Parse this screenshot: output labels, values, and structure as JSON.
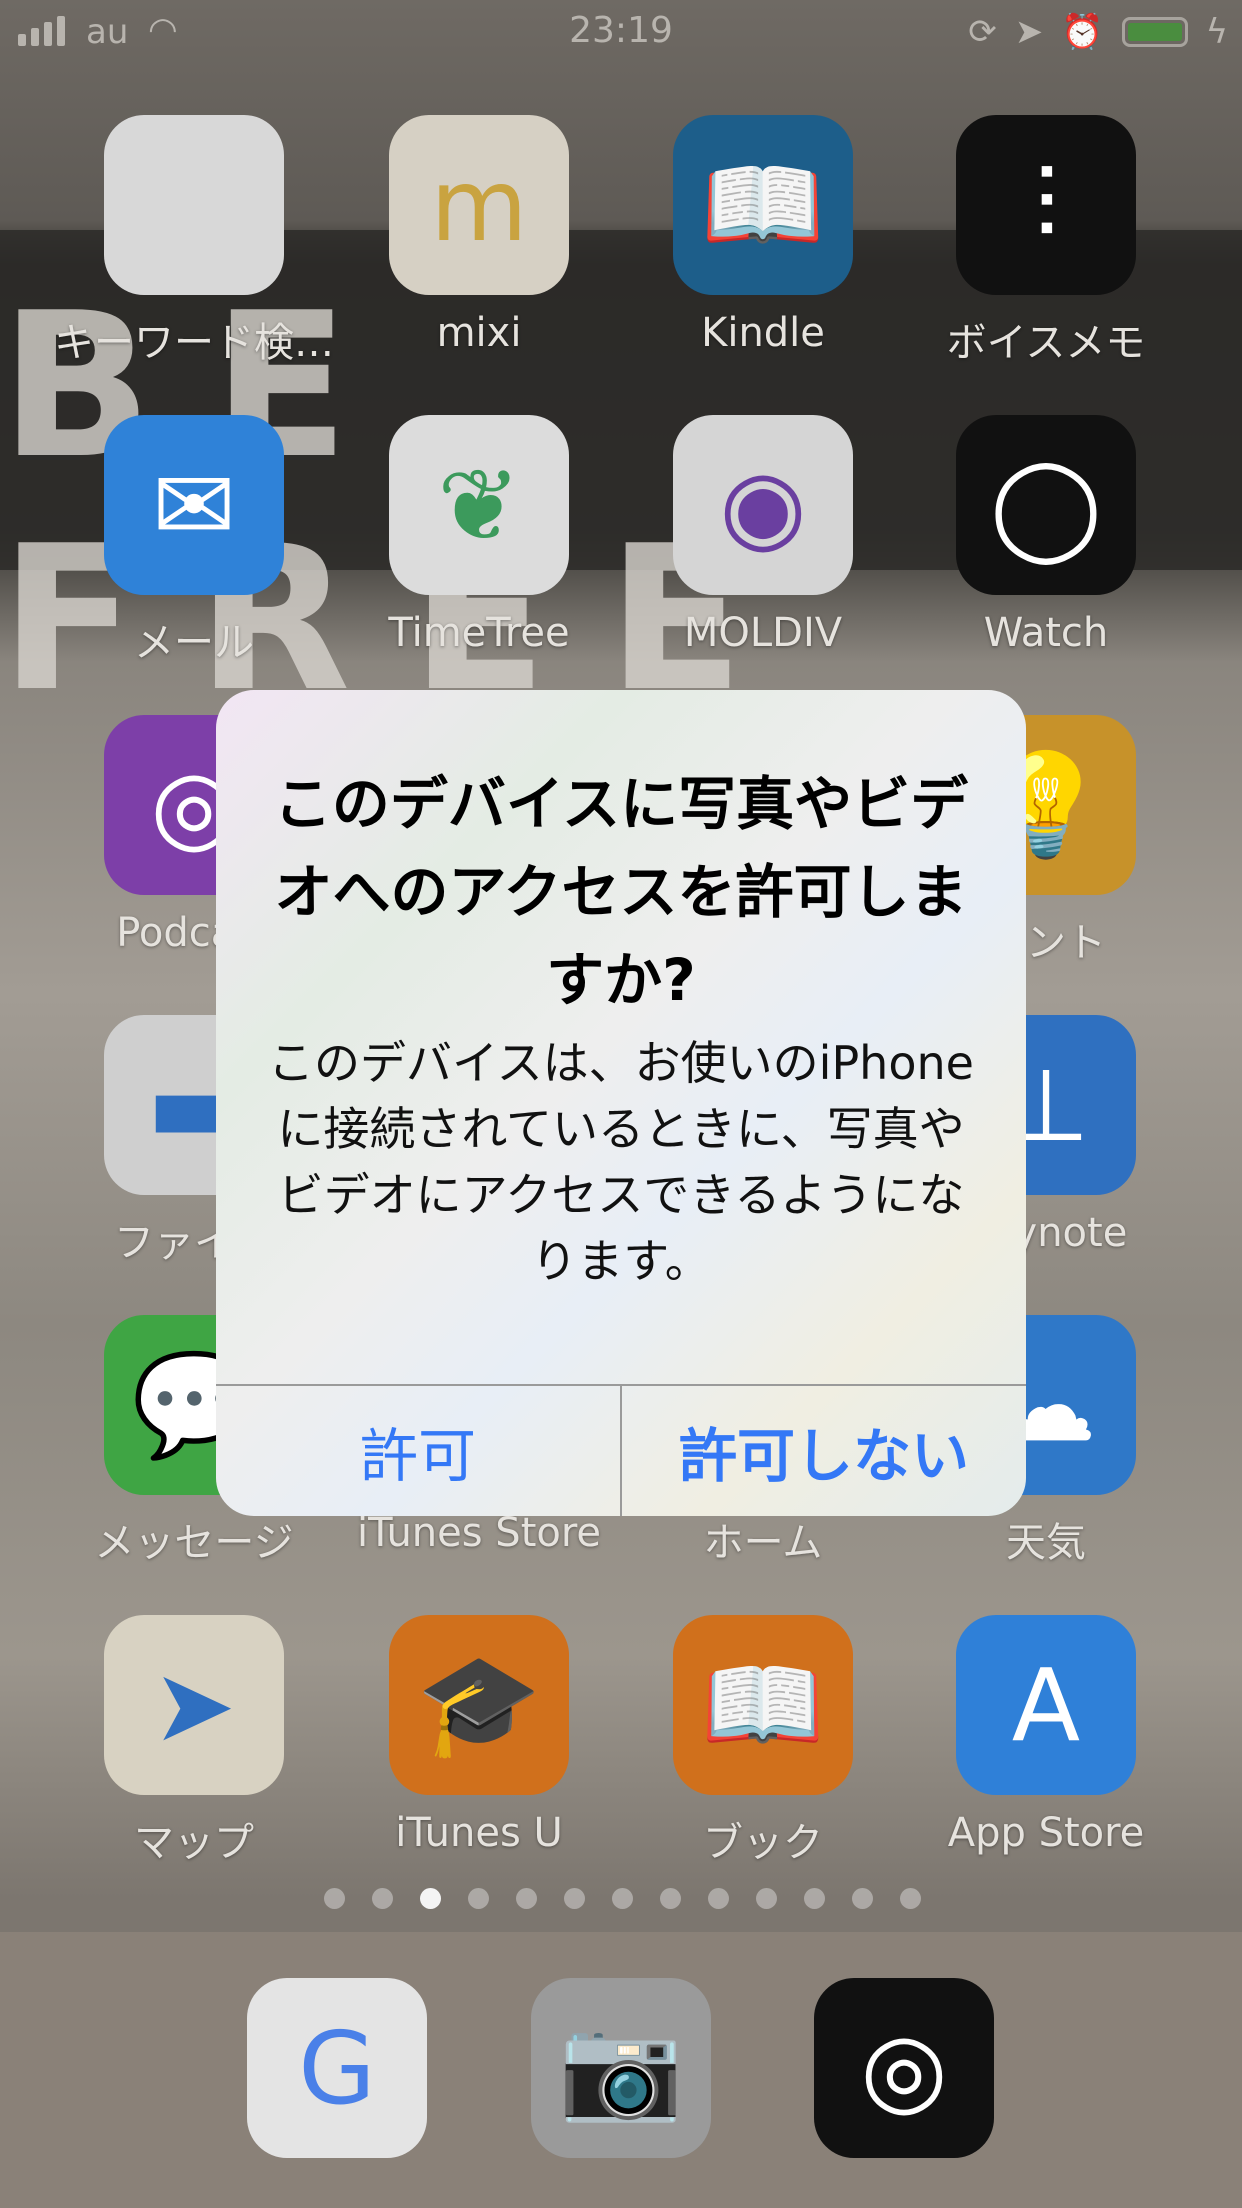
{
  "status_bar": {
    "carrier": "au",
    "time": "23:19",
    "battery_color": "#4a8d3f",
    "icons": [
      "signal-icon",
      "wifi-icon",
      "rotation-lock-icon",
      "location-icon",
      "alarm-icon",
      "battery-icon",
      "charging-icon"
    ]
  },
  "wallpaper_text": "BE FREE",
  "apps": [
    {
      "label": "キーワード検…",
      "color": "#d8d8d8",
      "glyph": ""
    },
    {
      "label": "mixi",
      "color": "#d6d0c4",
      "glyph": "m",
      "glyph_color": "#c9a340"
    },
    {
      "label": "Kindle",
      "color": "#1d5e8a",
      "glyph": "📖"
    },
    {
      "label": "ボイスメモ",
      "color": "#111111",
      "glyph": "⫶"
    },
    {
      "label": "メール",
      "color": "#2f82d8",
      "glyph": "✉"
    },
    {
      "label": "TimeTree",
      "color": "#dcdcdc",
      "glyph": "❦",
      "glyph_color": "#3c9a5c"
    },
    {
      "label": "MOLDIV",
      "color": "#d5d5d5",
      "glyph": "◉",
      "glyph_color": "#6a3fa0"
    },
    {
      "label": "Watch",
      "color": "#111111",
      "glyph": "◯"
    },
    {
      "label": "Podcast",
      "color": "#7d3fa8",
      "glyph": "◎"
    },
    {
      "label": "",
      "color": "#888",
      "glyph": ""
    },
    {
      "label": "",
      "color": "#888",
      "glyph": ""
    },
    {
      "label": "ヒント",
      "color": "#c7922a",
      "glyph": "💡"
    },
    {
      "label": "ファイル",
      "color": "#cfcfcf",
      "glyph": "▬",
      "glyph_color": "#2f6fc0"
    },
    {
      "label": "",
      "color": "#888",
      "glyph": ""
    },
    {
      "label": "",
      "color": "#888",
      "glyph": ""
    },
    {
      "label": "Keynote",
      "color": "#2f70c0",
      "glyph": "⊥"
    },
    {
      "label": "メッセージ",
      "color": "#3fa544",
      "glyph": "💬"
    },
    {
      "label": "iTunes Store",
      "color": "#888",
      "glyph": ""
    },
    {
      "label": "ホーム",
      "color": "#888",
      "glyph": ""
    },
    {
      "label": "天気",
      "color": "#2f78c8",
      "glyph": "☁"
    },
    {
      "label": "マップ",
      "color": "#d8d2c2",
      "glyph": "➤",
      "glyph_color": "#2f6fc0"
    },
    {
      "label": "iTunes U",
      "color": "#d0701c",
      "glyph": "🎓"
    },
    {
      "label": "ブック",
      "color": "#d0701c",
      "glyph": "📖"
    },
    {
      "label": "App Store",
      "color": "#2f80d8",
      "glyph": "A"
    }
  ],
  "page_dots": {
    "count": 13,
    "active": 3
  },
  "dock": [
    {
      "name": "google",
      "color": "#e4e4e4",
      "glyph": "G",
      "glyph_color": "#4a80e8"
    },
    {
      "name": "camera",
      "color": "#9a9a9a",
      "glyph": "📷"
    },
    {
      "name": "camera-app",
      "color": "#111111",
      "glyph": "◎"
    }
  ],
  "dialog": {
    "title": "このデバイスに写真やビデオへのアクセスを許可しますか?",
    "message": "このデバイスは、お使いのiPhoneに接続されているときに、写真やビデオにアクセスできるようになります。",
    "allow_label": "許可",
    "deny_label": "許可しない",
    "button_color": "#3478f6"
  }
}
